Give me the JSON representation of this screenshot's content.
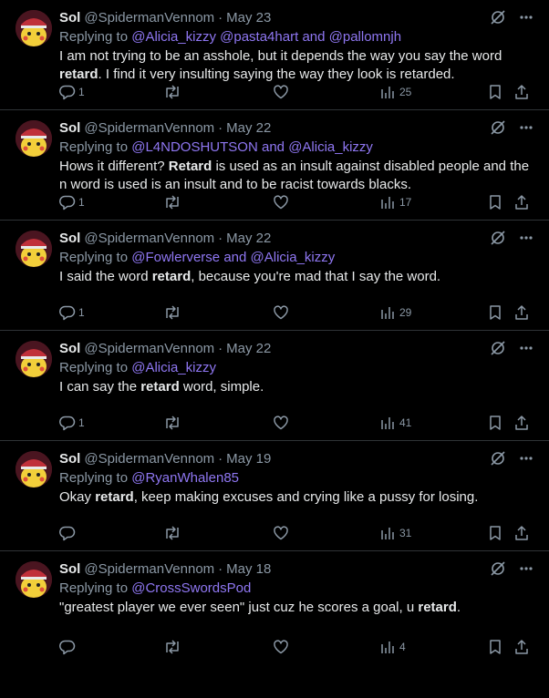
{
  "tweets": [
    {
      "name": "Sol",
      "handle": "@SpidermanVennom",
      "dot": "·",
      "date": "May 23",
      "replying_prefix": "Replying to",
      "mentions": [
        "@Alicia_kizzy",
        "@pasta4hart",
        "and",
        "@pallomnjh"
      ],
      "text": [
        {
          "t": "I am not trying to be an asshole, but it depends the way you say the word "
        },
        {
          "t": "retard",
          "b": true
        },
        {
          "t": ". I find it very insulting saying the way they look is retarded."
        }
      ],
      "replies": "1",
      "views": "25"
    },
    {
      "name": "Sol",
      "handle": "@SpidermanVennom",
      "dot": "·",
      "date": "May 22",
      "replying_prefix": "Replying to",
      "mentions": [
        "@L4NDOSHUTSON",
        "and",
        "@Alicia_kizzy"
      ],
      "text": [
        {
          "t": "Hows it different? "
        },
        {
          "t": "Retard",
          "b": true
        },
        {
          "t": " is used as an insult against disabled people and the n word is used is an insult and to be racist towards blacks."
        }
      ],
      "replies": "1",
      "views": "17"
    },
    {
      "name": "Sol",
      "handle": "@SpidermanVennom",
      "dot": "·",
      "date": "May 22",
      "replying_prefix": "Replying to",
      "mentions": [
        "@Fowlerverse",
        "and",
        "@Alicia_kizzy"
      ],
      "text": [
        {
          "t": "I said the word "
        },
        {
          "t": "retard",
          "b": true
        },
        {
          "t": ", because you're mad that I say the word."
        }
      ],
      "replies": "1",
      "views": "29"
    },
    {
      "name": "Sol",
      "handle": "@SpidermanVennom",
      "dot": "·",
      "date": "May 22",
      "replying_prefix": "Replying to",
      "mentions": [
        "@Alicia_kizzy"
      ],
      "text": [
        {
          "t": "I can say the "
        },
        {
          "t": "retard",
          "b": true
        },
        {
          "t": " word, simple."
        }
      ],
      "replies": "1",
      "views": "41"
    },
    {
      "name": "Sol",
      "handle": "@SpidermanVennom",
      "dot": "·",
      "date": "May 19",
      "replying_prefix": "Replying to",
      "mentions": [
        "@RyanWhalen85"
      ],
      "text": [
        {
          "t": "Okay "
        },
        {
          "t": "retard",
          "b": true
        },
        {
          "t": ", keep making excuses and crying like a pussy for losing."
        }
      ],
      "replies": "",
      "views": "31"
    },
    {
      "name": "Sol",
      "handle": "@SpidermanVennom",
      "dot": "·",
      "date": "May 18",
      "replying_prefix": "Replying to",
      "mentions": [
        "@CrossSwordsPod"
      ],
      "text": [
        {
          "t": "\"greatest player we ever seen\" just cuz he scores a goal, u "
        },
        {
          "t": "retard",
          "b": true
        },
        {
          "t": "."
        }
      ],
      "replies": "",
      "views": "4"
    }
  ],
  "icons": {
    "grok": "grok-icon",
    "more": "more-icon",
    "reply": "reply-icon",
    "retweet": "retweet-icon",
    "like": "heart-icon",
    "views": "views-icon",
    "bookmark": "bookmark-icon",
    "share": "share-icon"
  },
  "colors": {
    "background": "#000000",
    "text": "#e7e9ea",
    "muted": "#8b98a5",
    "mention": "#8f77f2",
    "divider": "#2f3336"
  }
}
